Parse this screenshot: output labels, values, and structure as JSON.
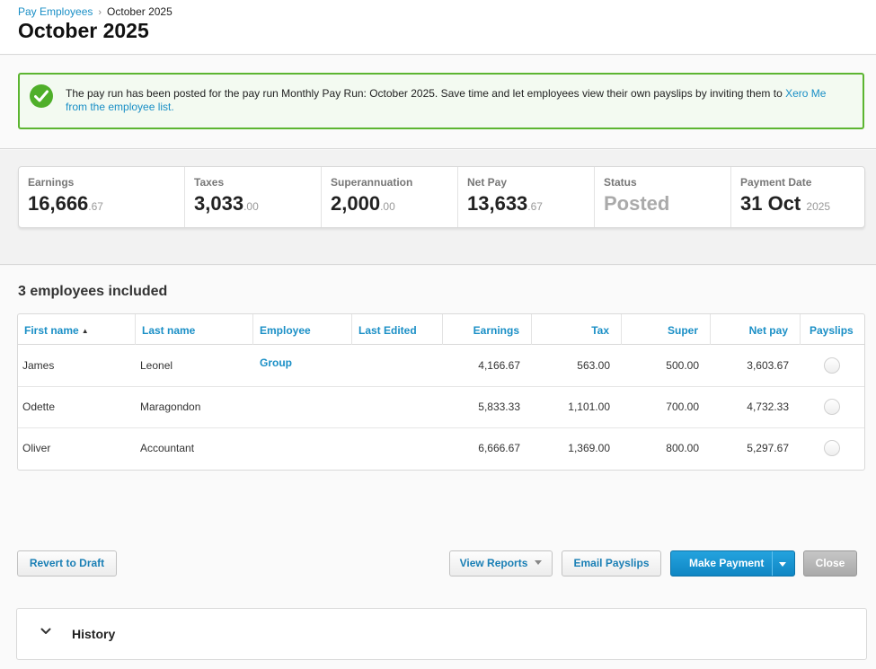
{
  "breadcrumb": {
    "parent": "Pay Employees",
    "separator": "›",
    "current": "October 2025"
  },
  "page_title": "October 2025",
  "banner": {
    "message": "The pay run has been posted for the pay run Monthly Pay Run: October 2025. Save time and let employees view their own payslips by inviting them to ",
    "link_text": "Xero Me from the employee list.",
    "accent_color": "#5cb531"
  },
  "summary": {
    "earnings": {
      "label": "Earnings",
      "whole": "16,666",
      "decimal": ".67"
    },
    "taxes": {
      "label": "Taxes",
      "whole": "3,033",
      "decimal": ".00"
    },
    "super": {
      "label": "Superannuation",
      "whole": "2,000",
      "decimal": ".00"
    },
    "net_pay": {
      "label": "Net Pay",
      "whole": "13,633",
      "decimal": ".67"
    },
    "status": {
      "label": "Status",
      "value": "Posted"
    },
    "payment_date": {
      "label": "Payment Date",
      "main": "31 Oct",
      "year": "2025"
    }
  },
  "employees_heading": "3 employees included",
  "table": {
    "headers": {
      "first_name": "First name",
      "last_name": "Last name",
      "employee_group": "Employee Group",
      "last_edited": "Last Edited",
      "earnings": "Earnings",
      "tax": "Tax",
      "super": "Super",
      "net_pay": "Net pay",
      "payslips": "Payslips"
    },
    "sort_indicator": "▲",
    "rows": [
      {
        "first": "James",
        "last": "Leonel",
        "group": "",
        "edited": "",
        "earnings": "4,166.67",
        "tax": "563.00",
        "super": "500.00",
        "net": "3,603.67"
      },
      {
        "first": "Odette",
        "last": "Maragondon",
        "group": "",
        "edited": "",
        "earnings": "5,833.33",
        "tax": "1,101.00",
        "super": "700.00",
        "net": "4,732.33"
      },
      {
        "first": "Oliver",
        "last": "Accountant",
        "group": "",
        "edited": "",
        "earnings": "6,666.67",
        "tax": "1,369.00",
        "super": "800.00",
        "net": "5,297.67"
      }
    ]
  },
  "actions": {
    "revert": "Revert to Draft",
    "view_reports": "View Reports",
    "email_payslips": "Email Payslips",
    "make_payment": "Make Payment",
    "close": "Close"
  },
  "history": {
    "title": "History",
    "icon": "chevron-down-icon"
  },
  "colors": {
    "link": "#1a8fc6",
    "primary": "#1a95d3",
    "success": "#4faf2a"
  }
}
